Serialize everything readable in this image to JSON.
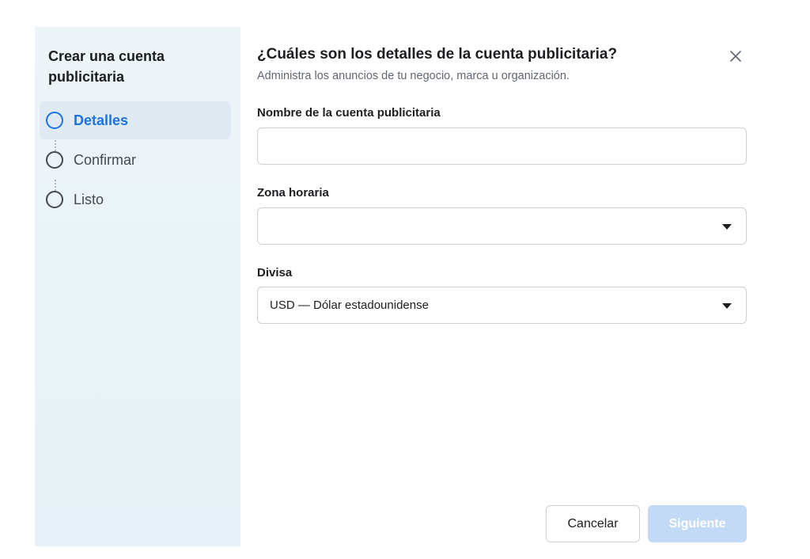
{
  "sidebar": {
    "title": "Crear una cuenta publicitaria",
    "steps": [
      {
        "label": "Detalles",
        "state": "active"
      },
      {
        "label": "Confirmar",
        "state": "pending"
      },
      {
        "label": "Listo",
        "state": "pending"
      }
    ]
  },
  "dialog": {
    "title": "¿Cuáles son los detalles de la cuenta publicitaria?",
    "subtitle": "Administra los anuncios de tu negocio, marca u organización.",
    "close_icon": "close-icon"
  },
  "form": {
    "account_name": {
      "label": "Nombre de la cuenta publicitaria",
      "value": ""
    },
    "timezone": {
      "label": "Zona horaria",
      "value": ""
    },
    "currency": {
      "label": "Divisa",
      "value": "USD — Dólar estadounidense"
    }
  },
  "buttons": {
    "cancel": "Cancelar",
    "next": "Siguiente"
  },
  "colors": {
    "accent": "#1b74e4",
    "disabled_button": "#c3daf7",
    "sidebar_bg": "#eef5f8"
  }
}
